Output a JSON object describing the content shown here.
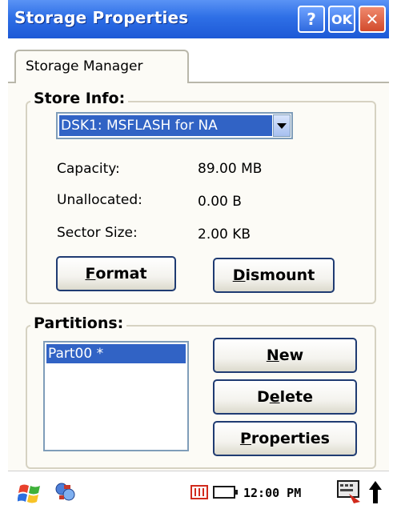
{
  "window": {
    "title": "Storage Properties",
    "help_label": "?",
    "ok_label": "OK",
    "close_label": "✕"
  },
  "tabs": [
    {
      "label": "Storage Manager",
      "selected": true
    }
  ],
  "store_info": {
    "group_title": "Store Info:",
    "selected_store": "DSK1: MSFLASH for NA",
    "capacity_label": "Capacity:",
    "capacity_value": "89.00 MB",
    "unallocated_label": "Unallocated:",
    "unallocated_value": "0.00 B",
    "sector_label": "Sector Size:",
    "sector_value": "2.00 KB",
    "format_button": {
      "accel": "F",
      "rest": "ormat"
    },
    "dismount_button": {
      "accel": "D",
      "rest": "ismount"
    }
  },
  "partitions": {
    "group_title": "Partitions:",
    "items": [
      "Part00 *"
    ],
    "new_button": {
      "accel": "N",
      "rest": "ew"
    },
    "delete_button": {
      "pre": "D",
      "accel": "e",
      "rest": "lete"
    },
    "properties_button": {
      "accel": "P",
      "rest": "roperties"
    }
  },
  "taskbar": {
    "time": "12:00 PM",
    "icons": [
      "start-windows-icon",
      "network-sync-icon",
      "memory-card-icon",
      "battery-icon",
      "keyboard-input-icon",
      "up-arrow-icon"
    ]
  },
  "colors": {
    "titlebar": "#2e6fe6",
    "selection": "#3163c5",
    "panel": "#fcfbf6",
    "close_button": "#d24a2c"
  }
}
